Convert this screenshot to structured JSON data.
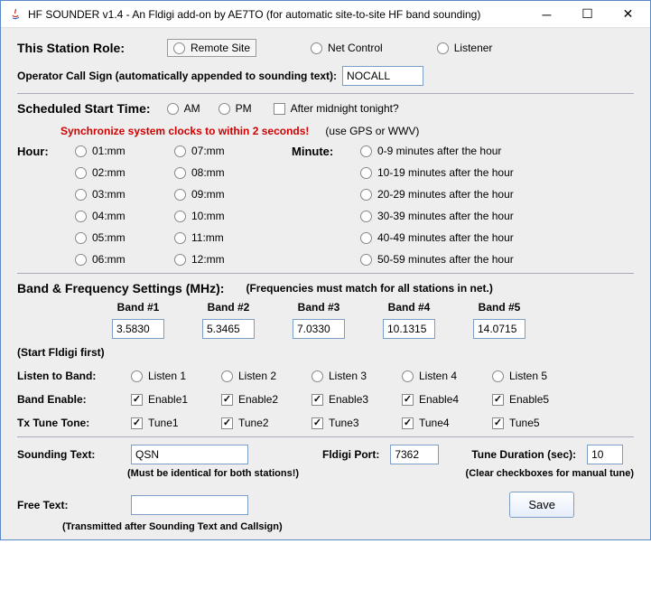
{
  "window": {
    "title": "HF SOUNDER v1.4 - An Fldigi add-on by AE7TO (for automatic site-to-site HF band sounding)"
  },
  "role": {
    "label": "This Station Role:",
    "remote": "Remote Site",
    "netcontrol": "Net Control",
    "listener": "Listener"
  },
  "opcall": {
    "label": "Operator Call Sign (automatically appended to sounding text):",
    "value": "NOCALL"
  },
  "sched": {
    "label": "Scheduled Start Time:",
    "am": "AM",
    "pm": "PM",
    "midnight": "After midnight tonight?",
    "sync_warn": "Synchronize system clocks to within 2 seconds!",
    "sync_note": "(use GPS or WWV)",
    "hour_label": "Hour:",
    "minute_label": "Minute:",
    "hours1": [
      "01:mm",
      "02:mm",
      "03:mm",
      "04:mm",
      "05:mm",
      "06:mm"
    ],
    "hours2": [
      "07:mm",
      "08:mm",
      "09:mm",
      "10:mm",
      "11:mm",
      "12:mm"
    ],
    "mins": [
      "0-9   minutes after the hour",
      "10-19 minutes after the hour",
      "20-29 minutes after the hour",
      "30-39 minutes after the hour",
      "40-49 minutes after the hour",
      "50-59 minutes after the hour"
    ]
  },
  "band": {
    "label": "Band & Frequency Settings (MHz):",
    "note": "(Frequencies must match for all stations in net.)",
    "headers": [
      "Band #1",
      "Band #2",
      "Band #3",
      "Band #4",
      "Band #5"
    ],
    "values": [
      "3.5830",
      "5.3465",
      "7.0330",
      "10.1315",
      "14.0715"
    ],
    "start_note": "(Start Fldigi first)",
    "listen_label": "Listen to Band:",
    "listen": [
      "Listen 1",
      "Listen 2",
      "Listen 3",
      "Listen 4",
      "Listen 5"
    ],
    "enable_label": "Band Enable:",
    "enable": [
      "Enable1",
      "Enable2",
      "Enable3",
      "Enable4",
      "Enable5"
    ],
    "tune_label": "Tx Tune Tone:",
    "tune": [
      "Tune1",
      "Tune2",
      "Tune3",
      "Tune4",
      "Tune5"
    ]
  },
  "snd": {
    "label": "Sounding Text:",
    "value": "QSN",
    "note": "(Must be identical for both stations!)",
    "port_label": "Fldigi Port:",
    "port_value": "7362",
    "dur_label": "Tune Duration (sec):",
    "dur_value": "10",
    "dur_note": "(Clear checkboxes for manual tune)"
  },
  "free": {
    "label": "Free Text:",
    "value": "",
    "note": "(Transmitted after Sounding Text and Callsign)"
  },
  "save": "Save"
}
